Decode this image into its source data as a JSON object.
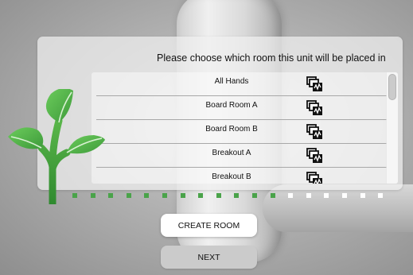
{
  "panel": {
    "title": "Please choose which room this unit will be placed in"
  },
  "rooms": [
    {
      "name": "All Hands",
      "icon": "dashboard-link-icon"
    },
    {
      "name": "Board Room A",
      "icon": "dashboard-link-icon"
    },
    {
      "name": "Board Room B",
      "icon": "dashboard-link-icon"
    },
    {
      "name": "Breakout A",
      "icon": "dashboard-link-icon"
    },
    {
      "name": "Breakout B",
      "icon": "dashboard-link-icon"
    }
  ],
  "progress": {
    "completed_steps": 12,
    "total_steps": 18,
    "done_color": "#4aa34a",
    "todo_color": "#ffffff"
  },
  "buttons": {
    "create_room": "CREATE ROOM",
    "next": "NEXT"
  },
  "colors": {
    "brand_green": "#4caf50"
  }
}
